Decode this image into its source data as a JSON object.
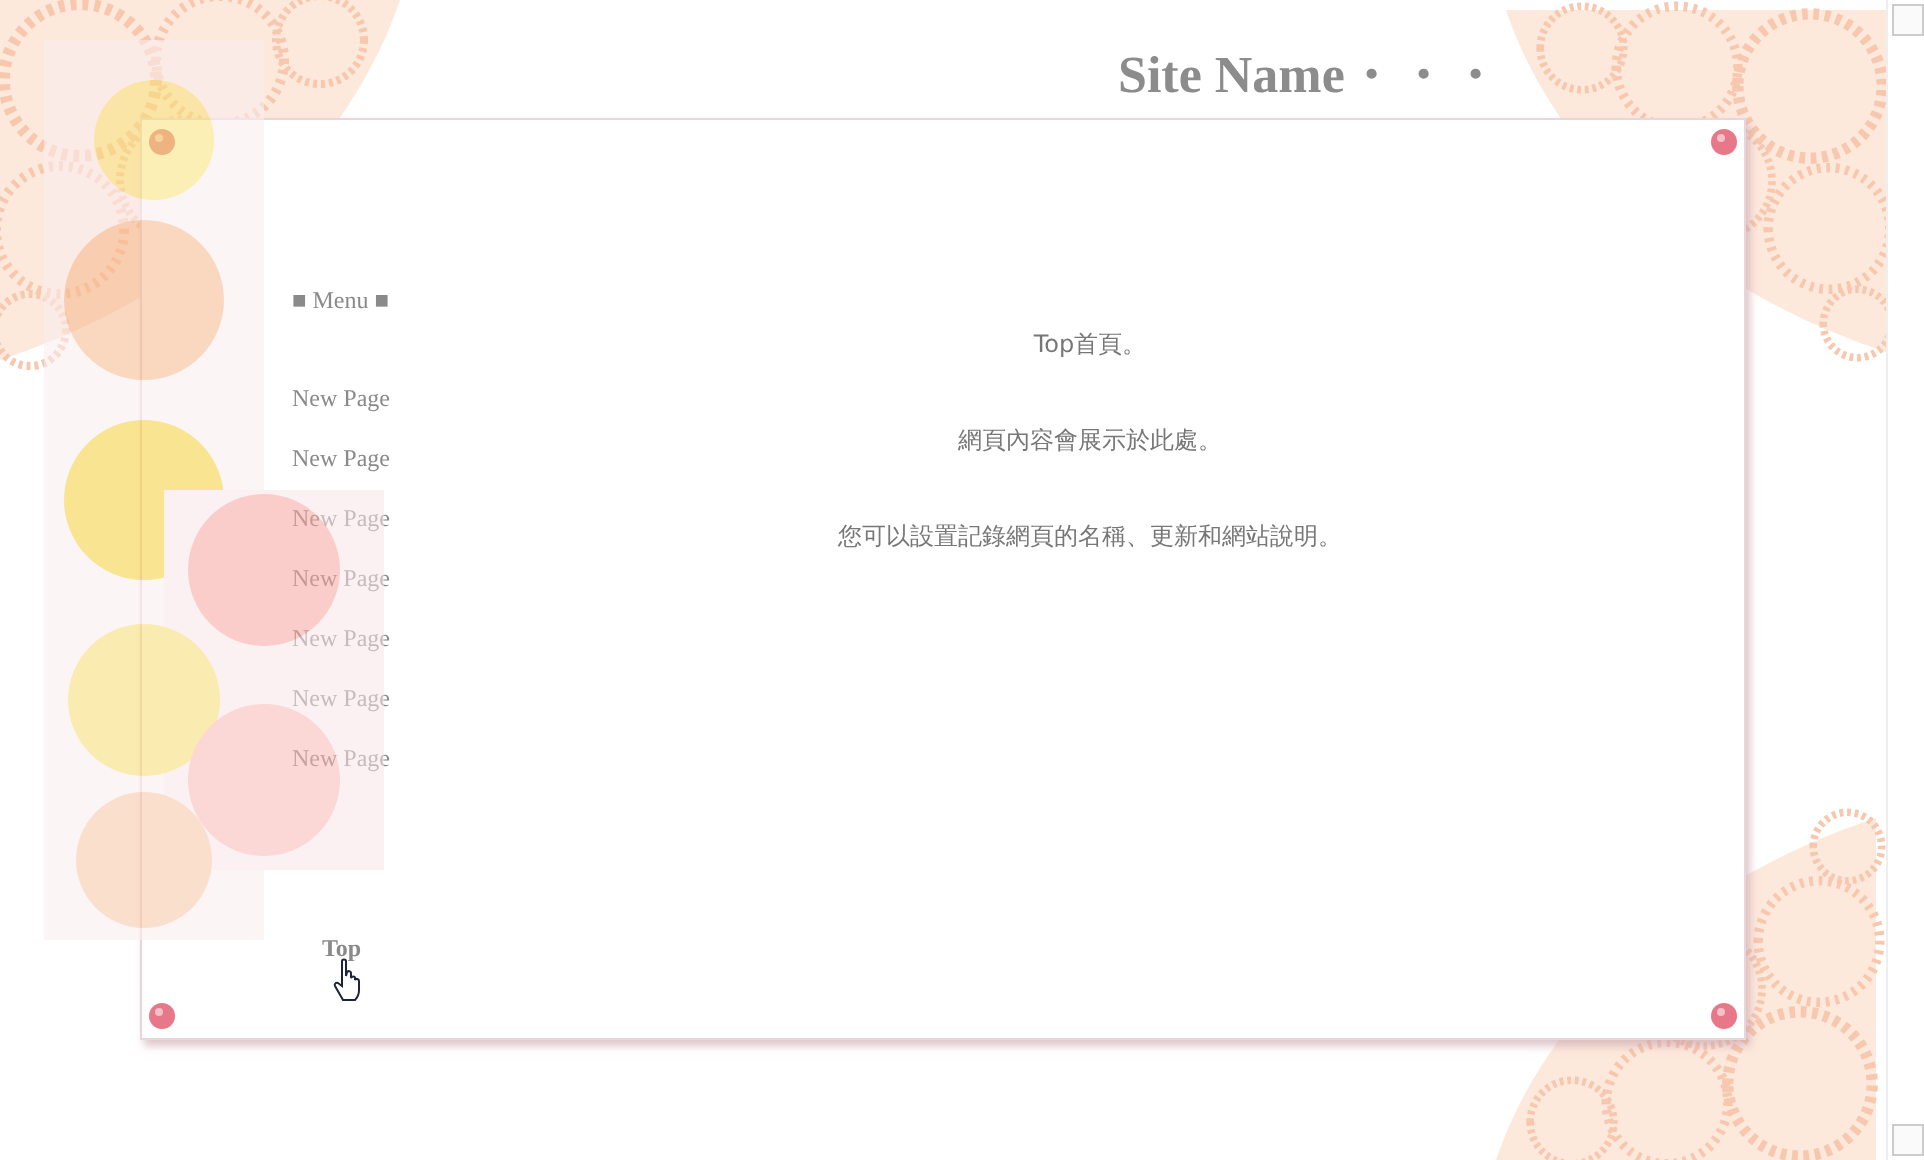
{
  "site_title": "Site Name・・・",
  "menu": {
    "heading": "■ Menu ■",
    "items": [
      {
        "label": "New Page"
      },
      {
        "label": "New Page"
      },
      {
        "label": "New Page"
      },
      {
        "label": "New Page"
      },
      {
        "label": "New Page"
      },
      {
        "label": "New Page"
      },
      {
        "label": "New Page"
      }
    ]
  },
  "content": {
    "paragraphs": [
      "Top首頁。",
      "網頁內容會展示於此處。",
      "您可以設置記錄網頁的名稱、更新和網站說明。"
    ]
  },
  "top_link": "Top"
}
